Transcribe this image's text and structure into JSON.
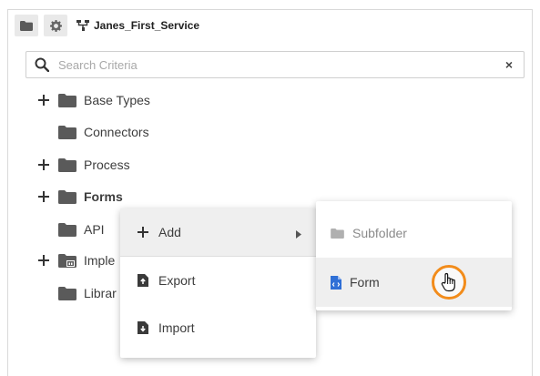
{
  "header": {
    "service_name": "Janes_First_Service",
    "folder_button_icon": "folder-icon",
    "settings_button_icon": "gear-icon"
  },
  "search": {
    "placeholder": "Search Criteria",
    "value": "",
    "clear_label": "×"
  },
  "tree": {
    "items": [
      {
        "label": "Base Types",
        "expandable": true,
        "bold": false
      },
      {
        "label": "Connectors",
        "expandable": false,
        "bold": false
      },
      {
        "label": "Process",
        "expandable": true,
        "bold": false
      },
      {
        "label": "Forms",
        "expandable": true,
        "bold": true
      },
      {
        "label": "API",
        "expandable": false,
        "bold": false
      },
      {
        "label": "Imple",
        "expandable": true,
        "bold": false
      },
      {
        "label": "Librar",
        "expandable": false,
        "bold": false
      }
    ]
  },
  "context_menu": {
    "items": [
      {
        "label": "Add",
        "icon": "plus-icon",
        "has_submenu": true
      },
      {
        "label": "Export",
        "icon": "export-icon"
      },
      {
        "label": "Import",
        "icon": "import-icon"
      }
    ]
  },
  "submenu": {
    "items": [
      {
        "label": "Subfolder",
        "icon": "folder-icon",
        "disabled": true
      },
      {
        "label": "Form",
        "icon": "form-file-icon",
        "disabled": false
      }
    ]
  },
  "colors": {
    "folder": "#5a5a5a",
    "form_icon": "#2f6fd6",
    "cursor_highlight": "#f28c1b"
  }
}
